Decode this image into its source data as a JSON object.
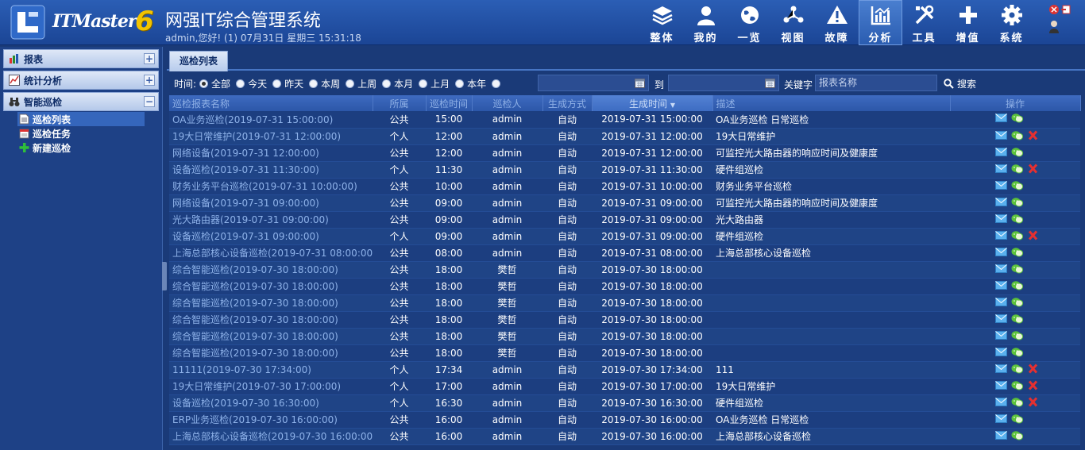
{
  "header": {
    "logo_text": "ITMaster",
    "logo_version": "6",
    "title": "网强IT综合管理系统",
    "user_status": "admin,您好! (1) 07月31日 星期三 15:31:18"
  },
  "topnav": [
    {
      "label": "整体",
      "icon": "layers-icon"
    },
    {
      "label": "我的",
      "icon": "user-icon"
    },
    {
      "label": "一览",
      "icon": "globe-icon"
    },
    {
      "label": "视图",
      "icon": "network-icon"
    },
    {
      "label": "故障",
      "icon": "warning-icon"
    },
    {
      "label": "分析",
      "icon": "chart-icon",
      "active": true
    },
    {
      "label": "工具",
      "icon": "tools-icon"
    },
    {
      "label": "增值",
      "icon": "plus-icon"
    },
    {
      "label": "系统",
      "icon": "gear-icon"
    }
  ],
  "sidebar": {
    "sections": [
      {
        "label": "报表",
        "toggle": "+"
      },
      {
        "label": "统计分析",
        "toggle": "+"
      },
      {
        "label": "智能巡检",
        "toggle": "−"
      }
    ],
    "items": [
      {
        "label": "巡检列表",
        "selected": true
      },
      {
        "label": "巡检任务"
      },
      {
        "label": "新建巡检"
      }
    ]
  },
  "tab": {
    "label": "巡检列表"
  },
  "filter": {
    "time_label": "时间:",
    "options": [
      "全部",
      "今天",
      "昨天",
      "本周",
      "上周",
      "本月",
      "上月",
      "本年"
    ],
    "selected": "全部",
    "to_label": "到",
    "keyword_label": "关键字",
    "keyword_placeholder": "报表名称",
    "search_label": "搜索"
  },
  "table": {
    "columns": [
      "巡检报表名称",
      "所属",
      "巡检时间",
      "巡检人",
      "生成方式",
      "生成时间",
      "描述",
      "操作"
    ],
    "sorted_column": "生成时间",
    "rows": [
      {
        "name": "OA业务巡检(2019-07-31 15:00:00)",
        "scope": "公共",
        "time": "15:00",
        "inspector": "admin",
        "mode": "自动",
        "gen": "2019-07-31 15:00:00",
        "desc": "OA业务巡检 日常巡检",
        "del": false
      },
      {
        "name": "19大日常维护(2019-07-31 12:00:00)",
        "scope": "个人",
        "time": "12:00",
        "inspector": "admin",
        "mode": "自动",
        "gen": "2019-07-31 12:00:00",
        "desc": "19大日常维护",
        "del": true
      },
      {
        "name": "网络设备(2019-07-31 12:00:00)",
        "scope": "公共",
        "time": "12:00",
        "inspector": "admin",
        "mode": "自动",
        "gen": "2019-07-31 12:00:00",
        "desc": "可监控光大路由器的响应时间及健康度",
        "del": false
      },
      {
        "name": "设备巡检(2019-07-31 11:30:00)",
        "scope": "个人",
        "time": "11:30",
        "inspector": "admin",
        "mode": "自动",
        "gen": "2019-07-31 11:30:00",
        "desc": "硬件组巡检",
        "del": true
      },
      {
        "name": "财务业务平台巡检(2019-07-31 10:00:00)",
        "scope": "公共",
        "time": "10:00",
        "inspector": "admin",
        "mode": "自动",
        "gen": "2019-07-31 10:00:00",
        "desc": "财务业务平台巡检",
        "del": false
      },
      {
        "name": "网络设备(2019-07-31 09:00:00)",
        "scope": "公共",
        "time": "09:00",
        "inspector": "admin",
        "mode": "自动",
        "gen": "2019-07-31 09:00:00",
        "desc": "可监控光大路由器的响应时间及健康度",
        "del": false
      },
      {
        "name": "光大路由器(2019-07-31 09:00:00)",
        "scope": "公共",
        "time": "09:00",
        "inspector": "admin",
        "mode": "自动",
        "gen": "2019-07-31 09:00:00",
        "desc": "光大路由器",
        "del": false
      },
      {
        "name": "设备巡检(2019-07-31 09:00:00)",
        "scope": "个人",
        "time": "09:00",
        "inspector": "admin",
        "mode": "自动",
        "gen": "2019-07-31 09:00:00",
        "desc": "硬件组巡检",
        "del": true
      },
      {
        "name": "上海总部核心设备巡检(2019-07-31 08:00:00)",
        "scope": "公共",
        "time": "08:00",
        "inspector": "admin",
        "mode": "自动",
        "gen": "2019-07-31 08:00:00",
        "desc": "上海总部核心设备巡检",
        "del": false
      },
      {
        "name": "综合智能巡检(2019-07-30 18:00:00)",
        "scope": "公共",
        "time": "18:00",
        "inspector": "樊哲",
        "mode": "自动",
        "gen": "2019-07-30 18:00:00",
        "desc": "",
        "del": false
      },
      {
        "name": "综合智能巡检(2019-07-30 18:00:00)",
        "scope": "公共",
        "time": "18:00",
        "inspector": "樊哲",
        "mode": "自动",
        "gen": "2019-07-30 18:00:00",
        "desc": "",
        "del": false
      },
      {
        "name": "综合智能巡检(2019-07-30 18:00:00)",
        "scope": "公共",
        "time": "18:00",
        "inspector": "樊哲",
        "mode": "自动",
        "gen": "2019-07-30 18:00:00",
        "desc": "",
        "del": false
      },
      {
        "name": "综合智能巡检(2019-07-30 18:00:00)",
        "scope": "公共",
        "time": "18:00",
        "inspector": "樊哲",
        "mode": "自动",
        "gen": "2019-07-30 18:00:00",
        "desc": "",
        "del": false
      },
      {
        "name": "综合智能巡检(2019-07-30 18:00:00)",
        "scope": "公共",
        "time": "18:00",
        "inspector": "樊哲",
        "mode": "自动",
        "gen": "2019-07-30 18:00:00",
        "desc": "",
        "del": false
      },
      {
        "name": "综合智能巡检(2019-07-30 18:00:00)",
        "scope": "公共",
        "time": "18:00",
        "inspector": "樊哲",
        "mode": "自动",
        "gen": "2019-07-30 18:00:00",
        "desc": "",
        "del": false
      },
      {
        "name": "11111(2019-07-30 17:34:00)",
        "scope": "个人",
        "time": "17:34",
        "inspector": "admin",
        "mode": "自动",
        "gen": "2019-07-30 17:34:00",
        "desc": "111",
        "del": true
      },
      {
        "name": "19大日常维护(2019-07-30 17:00:00)",
        "scope": "个人",
        "time": "17:00",
        "inspector": "admin",
        "mode": "自动",
        "gen": "2019-07-30 17:00:00",
        "desc": "19大日常维护",
        "del": true
      },
      {
        "name": "设备巡检(2019-07-30 16:30:00)",
        "scope": "个人",
        "time": "16:30",
        "inspector": "admin",
        "mode": "自动",
        "gen": "2019-07-30 16:30:00",
        "desc": "硬件组巡检",
        "del": true
      },
      {
        "name": "ERP业务巡检(2019-07-30 16:00:00)",
        "scope": "公共",
        "time": "16:00",
        "inspector": "admin",
        "mode": "自动",
        "gen": "2019-07-30 16:00:00",
        "desc": "OA业务巡检 日常巡检",
        "del": false
      },
      {
        "name": "上海总部核心设备巡检(2019-07-30 16:00:00)",
        "scope": "公共",
        "time": "16:00",
        "inspector": "admin",
        "mode": "自动",
        "gen": "2019-07-30 16:00:00",
        "desc": "上海总部核心设备巡检",
        "del": false
      }
    ]
  }
}
